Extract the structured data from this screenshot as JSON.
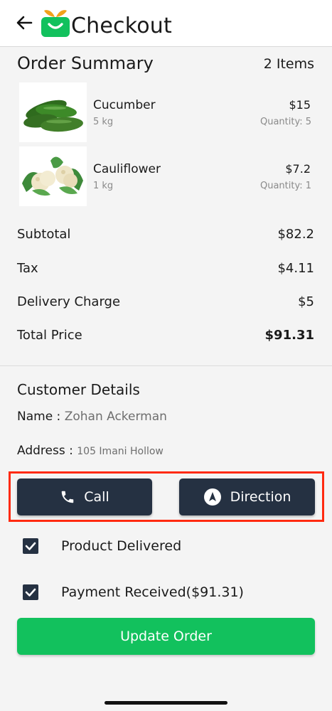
{
  "header": {
    "title": "Checkout"
  },
  "order_summary": {
    "title": "Order Summary",
    "count": "2 Items",
    "items": [
      {
        "name": "Cucumber",
        "weight": "5 kg",
        "price": "$15",
        "quantity": "Quantity: 5"
      },
      {
        "name": "Cauliflower",
        "weight": "1 kg",
        "price": "$7.2",
        "quantity": "Quantity: 1"
      }
    ]
  },
  "totals": {
    "subtotal_label": "Subtotal",
    "subtotal": "$82.2",
    "tax_label": "Tax",
    "tax": "$4.11",
    "delivery_label": "Delivery Charge",
    "delivery": "$5",
    "total_label": "Total Price",
    "total": "$91.31"
  },
  "customer": {
    "title": "Customer Details",
    "name_label": "Name : ",
    "name": "Zohan Ackerman",
    "address_label": "Address : ",
    "address": "105 Imani Hollow"
  },
  "actions": {
    "call_label": "Call",
    "direction_label": "Direction"
  },
  "checks": [
    {
      "label": "Product Delivered",
      "checked": true
    },
    {
      "label": "Payment Received($91.31)",
      "checked": true
    }
  ],
  "update_label": "Update Order",
  "colors": {
    "accent": "#12c15d",
    "dark_button": "#253142",
    "highlight": "#ff2a10"
  }
}
